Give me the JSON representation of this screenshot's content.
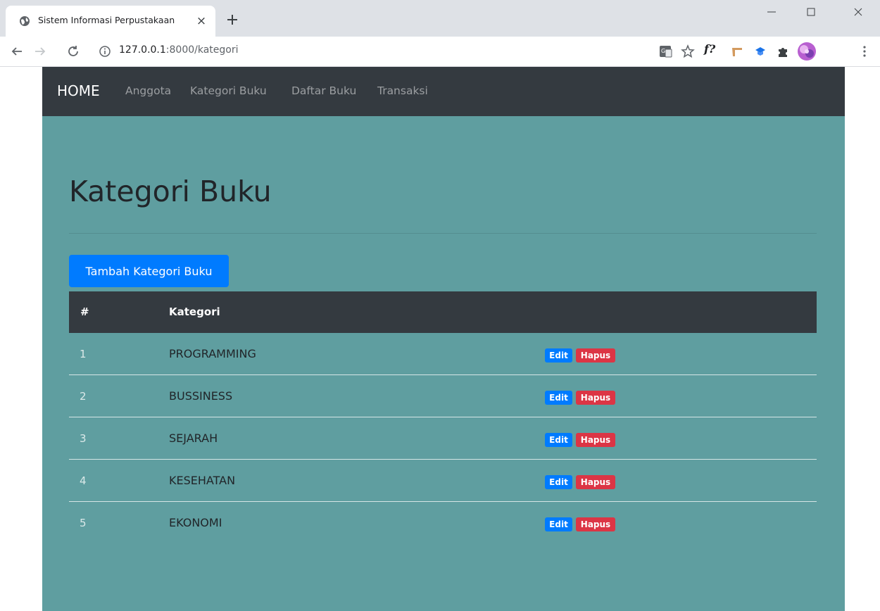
{
  "browser": {
    "tab_title": "Sistem Informasi Perpustakaan",
    "tab_close": "×",
    "url_host": "127.0.0.1",
    "url_path": ":8000/kategori",
    "icons": [
      "globe-icon",
      "close-icon",
      "plus-icon",
      "minimize-icon",
      "maximize-icon",
      "window-close-icon",
      "back-icon",
      "forward-icon",
      "reload-icon",
      "info-icon",
      "translate-icon",
      "star-icon",
      "formula-icon",
      "extension-icon",
      "puzzle-icon",
      "avatar",
      "menu-icon"
    ],
    "formula_label": "f?"
  },
  "navbar": {
    "brand": "HOME",
    "links": [
      "Anggota",
      "Kategori Buku",
      "Daftar Buku",
      "Transaksi"
    ]
  },
  "main": {
    "title": "Kategori Buku",
    "add_button": "Tambah Kategori Buku",
    "table": {
      "headers": [
        "#",
        "Kategori"
      ],
      "rows": [
        {
          "no": "1",
          "kategori": "PROGRAMMING",
          "edit": "Edit",
          "hapus": "Hapus"
        },
        {
          "no": "2",
          "kategori": "BUSSINESS",
          "edit": "Edit",
          "hapus": "Hapus"
        },
        {
          "no": "3",
          "kategori": "SEJARAH",
          "edit": "Edit",
          "hapus": "Hapus"
        },
        {
          "no": "4",
          "kategori": "KESEHATAN",
          "edit": "Edit",
          "hapus": "Hapus"
        },
        {
          "no": "5",
          "kategori": "EKONOMI",
          "edit": "Edit",
          "hapus": "Hapus"
        }
      ]
    }
  },
  "colors": {
    "navbar_bg": "#343a40",
    "jumbotron_bg": "#5f9ea0",
    "primary": "#007bff",
    "danger": "#dc3545"
  }
}
